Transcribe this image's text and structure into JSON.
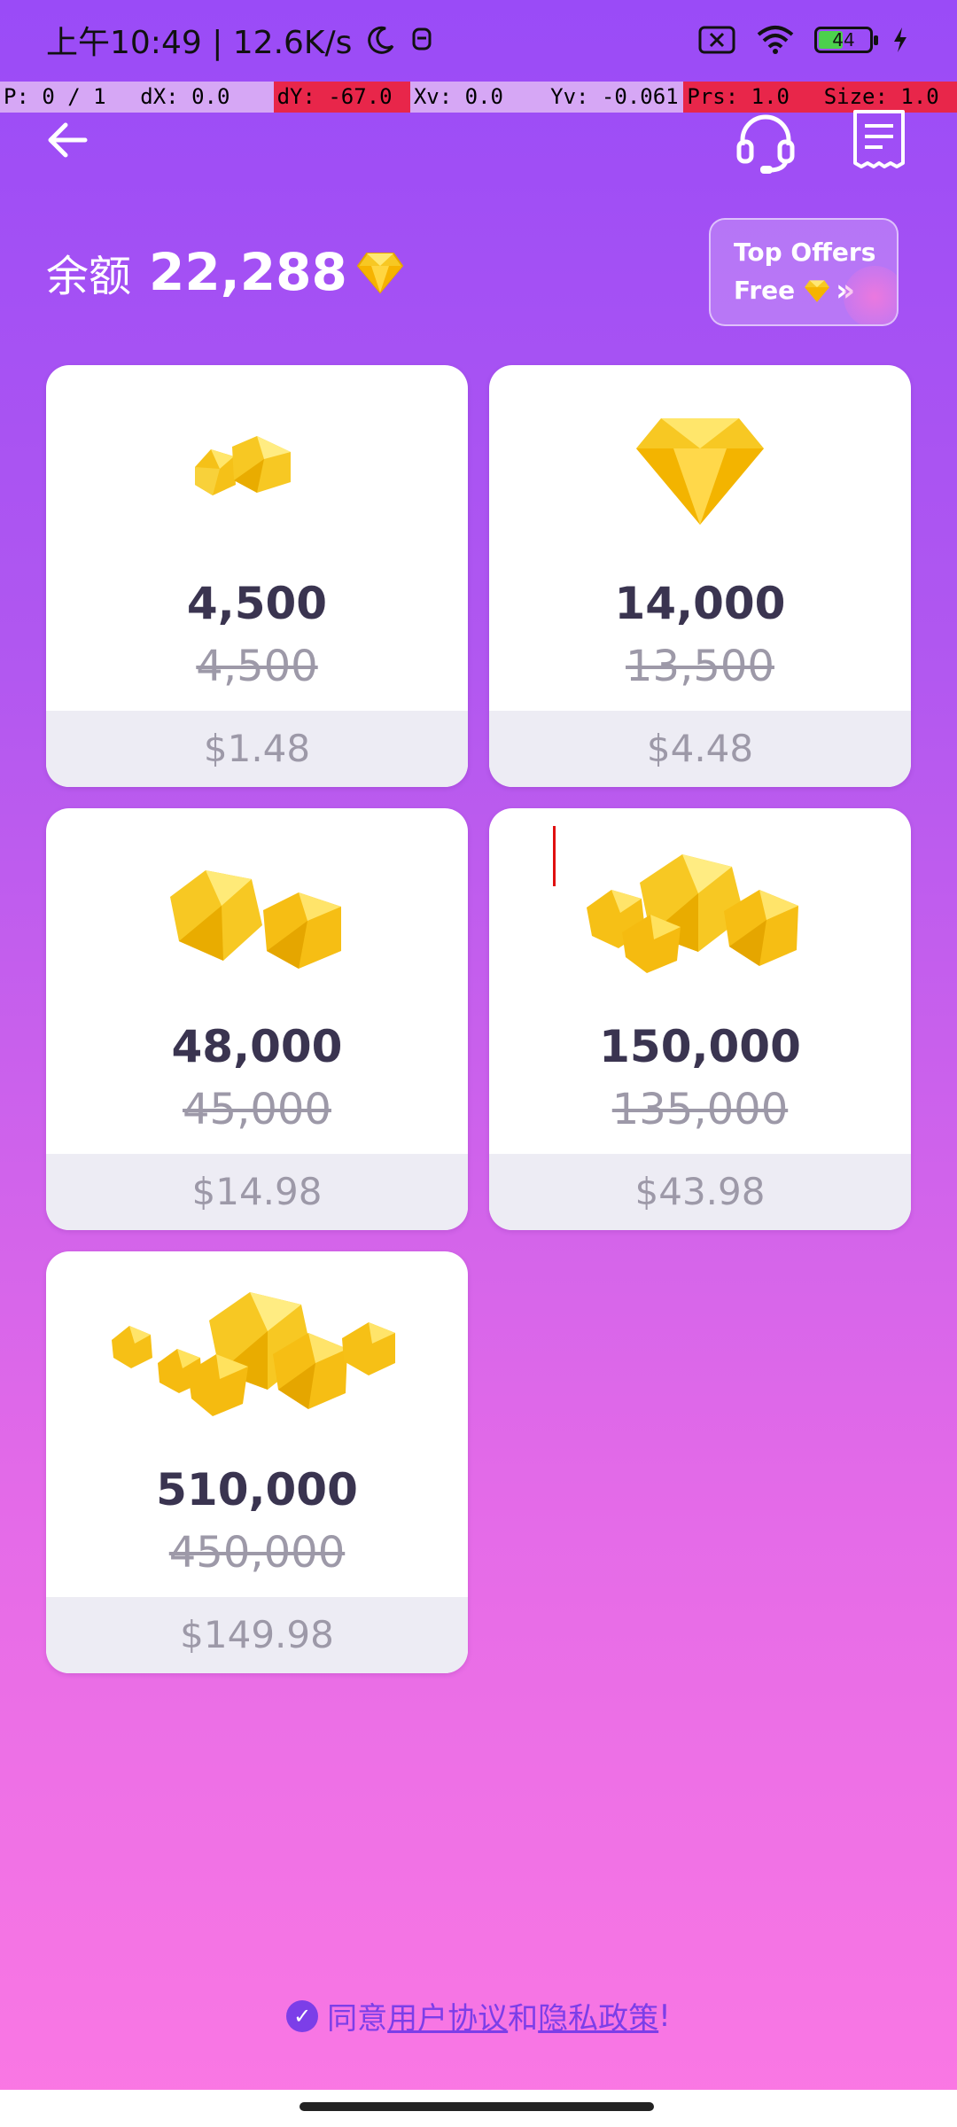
{
  "status_bar": {
    "time": "上午10:49 | 12.6K/s",
    "battery": "44"
  },
  "debug": {
    "cells": [
      "P: 0 / 1",
      "dX: 0.0",
      "dY: -67.0",
      "Xv: 0.0",
      "Yv: -0.061",
      "Prs: 1.0",
      "Size: 1.0"
    ]
  },
  "balance": {
    "label": "余额",
    "value": "22,288"
  },
  "top_offers": {
    "line1": "Top Offers",
    "line2": "Free"
  },
  "packages": [
    {
      "amount": "4,500",
      "original": "4,500",
      "price": "$1.48"
    },
    {
      "amount": "14,000",
      "original": "13,500",
      "price": "$4.48"
    },
    {
      "amount": "48,000",
      "original": "45,000",
      "price": "$14.98"
    },
    {
      "amount": "150,000",
      "original": "135,000",
      "price": "$43.98"
    },
    {
      "amount": "510,000",
      "original": "450,000",
      "price": "$149.98"
    }
  ],
  "agreement": {
    "prefix": "同意",
    "terms": "用户协议",
    "and": "和",
    "privacy": "隐私政策",
    "suffix": "!"
  },
  "colors": {
    "gem_gold": "#f7c823",
    "accent_purple": "#7c3ee8"
  }
}
